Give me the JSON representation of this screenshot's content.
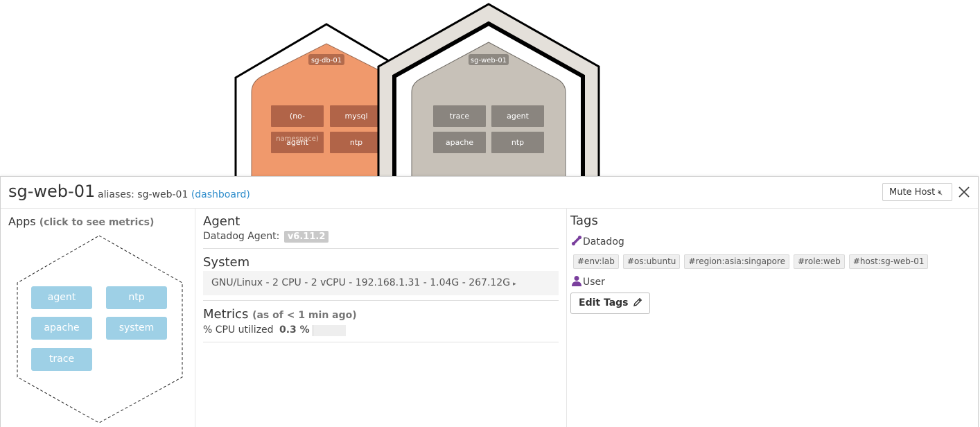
{
  "hostmap": {
    "hosts": [
      {
        "name": "sg-db-01",
        "tiles": [
          "(no-",
          "mysql",
          "agent",
          "ntp"
        ],
        "namespace_overlay": "namespace)"
      },
      {
        "name": "sg-web-01",
        "tiles": [
          "trace",
          "agent",
          "apache",
          "ntp"
        ]
      }
    ],
    "colors": {
      "db_fill": "#f0996c",
      "web_fill": "#c7c1b8",
      "web_ring": "#e4e0da"
    }
  },
  "panel": {
    "host_name": "sg-web-01",
    "aliases_label": "aliases: sg-web-01",
    "dashboard_link": "(dashboard)",
    "mute_button": "Mute Host",
    "mute_icon": "muted-speaker-icon",
    "close_icon": "close-icon"
  },
  "apps": {
    "title": "Apps",
    "subtitle": "(click to see metrics)",
    "items": [
      "agent",
      "ntp",
      "apache",
      "system",
      "trace"
    ],
    "color": "#9ed0e6"
  },
  "agent": {
    "title": "Agent",
    "label": "Datadog Agent:",
    "version": "v6.11.2"
  },
  "system": {
    "title": "System",
    "summary": "GNU/Linux - 2 CPU - 2 vCPU - 192.168.1.31 - 1.04G - 267.12G"
  },
  "metrics": {
    "title": "Metrics",
    "subtitle": "(as of < 1 min ago)",
    "cpu_label": "% CPU utilized",
    "cpu_value": "0.3 %",
    "cpu_fraction": 0.003
  },
  "tags": {
    "title": "Tags",
    "datadog_label": "Datadog",
    "datadog_tags": [
      "#env:lab",
      "#os:ubuntu",
      "#region:asia:singapore",
      "#role:web",
      "#host:sg-web-01"
    ],
    "user_label": "User",
    "edit_button": "Edit Tags",
    "accent": "#7a3f9d"
  }
}
